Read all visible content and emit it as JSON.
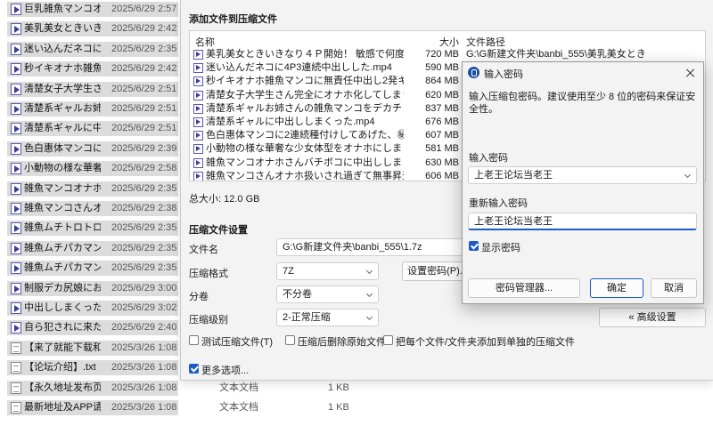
{
  "explorer": {
    "rows": [
      {
        "name": "巨乳雑魚マンコオナ…",
        "date": "2025/6/29 2:57",
        "type": "",
        "size": "",
        "icon": "video-file-icon"
      },
      {
        "name": "美乳美女ときいきなり…",
        "date": "2025/6/29 2:42",
        "type": "",
        "size": "",
        "icon": "video-file-icon"
      },
      {
        "name": "迷い込んだネコに4…",
        "date": "2025/6/29 2:35",
        "type": "",
        "size": "",
        "icon": "video-file-icon"
      },
      {
        "name": "秒イキオナホ雑魚…",
        "date": "2025/6/29 2:42",
        "type": "",
        "size": "",
        "icon": "video-file-icon"
      },
      {
        "name": "清楚女子大学生さ…",
        "date": "2025/6/29 2:51",
        "type": "",
        "size": "",
        "icon": "video-file-icon"
      },
      {
        "name": "清楚系ギャルお姉…",
        "date": "2025/6/29 2:51",
        "type": "",
        "size": "",
        "icon": "video-file-icon"
      },
      {
        "name": "清楚系ギャルに中…",
        "date": "2025/6/29 2:51",
        "type": "",
        "size": "",
        "icon": "video-file-icon"
      },
      {
        "name": "色白惠体マンコに2…",
        "date": "2025/6/29 2:39",
        "type": "",
        "size": "",
        "icon": "video-file-icon"
      },
      {
        "name": "小動物の様な華奢…",
        "date": "2025/6/29 2:58",
        "type": "",
        "size": "",
        "icon": "video-file-icon"
      },
      {
        "name": "雑魚マンコオナホ…",
        "date": "2025/6/29 2:35",
        "type": "",
        "size": "",
        "icon": "video-file-icon"
      },
      {
        "name": "雑魚マンコさんオナ…",
        "date": "2025/6/29 2:38",
        "type": "",
        "size": "",
        "icon": "video-file-icon"
      },
      {
        "name": "雑魚ムチトロトロ…",
        "date": "2025/6/29 2:35",
        "type": "",
        "size": "",
        "icon": "video-file-icon"
      },
      {
        "name": "雑魚ムチパカマン…",
        "date": "2025/6/29 2:35",
        "type": "",
        "size": "",
        "icon": "video-file-icon"
      },
      {
        "name": "雑魚ムチパカマン…",
        "date": "2025/6/29 2:35",
        "type": "",
        "size": "",
        "icon": "video-file-icon"
      },
      {
        "name": "制服デカ尻娘にお…",
        "date": "2025/6/29 3:00",
        "type": "",
        "size": "",
        "icon": "video-file-icon"
      },
      {
        "name": "中出ししまくった…",
        "date": "2025/6/29 3:02",
        "type": "",
        "size": "",
        "icon": "video-file-icon"
      },
      {
        "name": "自ら犯されに来た…",
        "date": "2025/6/29 2:40",
        "type": "",
        "size": "",
        "icon": "video-file-icon"
      },
      {
        "name": "【来了就能下载和…",
        "date": "2025/3/26 1:08",
        "type": "",
        "size": "",
        "icon": "text-file-icon"
      },
      {
        "name": "【论坛介绍】.txt",
        "date": "2025/3/26 1:08",
        "type": "",
        "size": "",
        "icon": "text-file-icon"
      },
      {
        "name": "【永久地址发布页…",
        "date": "2025/3/26 1:08",
        "type": "文本文档",
        "size": "1 KB",
        "icon": "text-file-icon"
      },
      {
        "name": "最新地址及APP请…",
        "date": "2025/3/26 1:08",
        "type": "文本文档",
        "size": "1 KB",
        "icon": "text-file-icon"
      }
    ]
  },
  "main_dialog": {
    "add_title": "添加文件到压缩文件",
    "table": {
      "col_name": "名称",
      "col_size": "大小",
      "col_path": "文件路径",
      "rows": [
        {
          "name": "美乳美女ときいきなり４Ｐ開始！ 敏感で何度もイキ…",
          "size": "720 MB",
          "path": "G:\\G新建文件夹\\banbi_555\\美乳美女ときいきなり…"
        },
        {
          "name": "迷い込んだネコに4P3連続中出しした.mp4",
          "size": "590 MB",
          "path": "G:\\G新建文件夹\\banbi_555"
        },
        {
          "name": "秒イキオナホ雑魚マンコに無責任中出し2発キメ…",
          "size": "864 MB",
          "path": "G:\\G新建文件夹\\banbi_555"
        },
        {
          "name": "清楚女子大学生さん完全にオナホ化してしまう。…",
          "size": "620 MB",
          "path": "G:\\G新建文件夹\\banbi_555"
        },
        {
          "name": "清楚系ギャルお姉さんの雑魚マンコをデカチンで…",
          "size": "837 MB",
          "path": "G:\\G新建文件夹\\banbi_555"
        },
        {
          "name": "清楚系ギャルに中出ししまくった.mp4",
          "size": "676 MB",
          "path": "G:\\G新建文件夹\\banbi_555"
        },
        {
          "name": "色白惠体マンコに2連続種付けしてあげた、㊙.m…",
          "size": "607 MB",
          "path": "G:\\G新建文件夹\\banbi_555"
        },
        {
          "name": "小動物の様な華奢な少女体型をオナホにしまくっ…",
          "size": "581 MB",
          "path": "G:\\G新建文件夹\\banbi_555"
        },
        {
          "name": "雑魚マンコオナホさんバチボコに中出ししまくっ…",
          "size": "630 MB",
          "path": "G:\\G新建文件夹\\banbi_555"
        },
        {
          "name": "雑魚マンコさんオナホ扱いされ過ぎて無事昇天、…",
          "size": "606 MB",
          "path": "G:\\G新建文件夹\\banbi_555"
        }
      ]
    },
    "total_size": "总大小: 12.0 GB",
    "settings_title": "压缩文件设置",
    "filename_label": "文件名",
    "filename_value": "G:\\G新建文件夹\\banbi_555\\1.7z",
    "format_label": "压缩格式",
    "format_value": "7Z",
    "set_password_button": "设置密码(P)...",
    "split_label": "分卷",
    "split_value": "不分卷",
    "level_label": "压缩级别",
    "level_value": "2-正常压缩",
    "advanced_button": "« 高级设置",
    "opt_test": "测试压缩文件(T)",
    "opt_delete": "压缩后删除原始文件",
    "opt_separate": "把每个文件/文件夹添加到单独的压缩文件",
    "more_options": "更多选项..."
  },
  "password_dialog": {
    "title": "输入密码",
    "hint": "输入压缩包密码。建议使用至少 8 位的密码来保证安全性。",
    "enter_label": "输入密码",
    "enter_value": "上老王论坛当老王",
    "reenter_label": "重新输入密码",
    "reenter_value": "上老王论坛当老王",
    "show_password": "显示密码",
    "manager_button": "密码管理器...",
    "ok_button": "确定",
    "cancel_button": "取消"
  },
  "colors": {
    "accent": "#1c5cc4",
    "dialog_bg": "#f3f3f3",
    "row_highlight": "#dcdcdc"
  }
}
